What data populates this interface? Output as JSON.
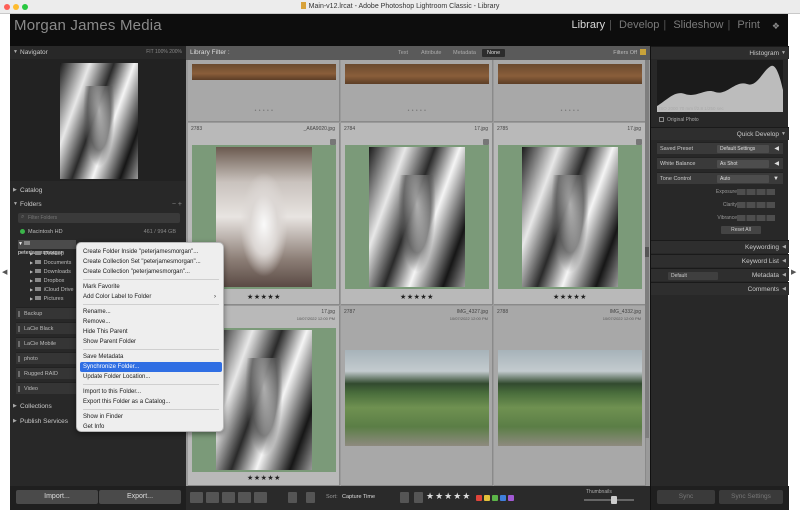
{
  "window": {
    "title": "Main-v12.lrcat - Adobe Photoshop Lightroom Classic - Library",
    "traffic_colors": [
      "#fe5f57",
      "#febc2e",
      "#28c840"
    ]
  },
  "header": {
    "identity_plate": "Morgan James Media",
    "modules": [
      "Library",
      "Develop",
      "Slideshow",
      "Print"
    ],
    "active_module": "Library"
  },
  "left_panel": {
    "navigator": {
      "title": "Navigator",
      "zoom_options": "FIT  100%  200%"
    },
    "catalog": {
      "title": "Catalog"
    },
    "folders": {
      "title": "Folders",
      "search_placeholder": "Filter Folders",
      "volume": {
        "name": "Macintosh HD",
        "meta": "461 / 994 GB"
      },
      "root_folder": "peterjamesmorgan",
      "subfolders": [
        "Desktop",
        "Documents",
        "Downloads",
        "Dropbox",
        "iCloud Drive",
        "Pictures"
      ],
      "drives": [
        "Backup",
        "LaCie Black",
        "LaCie Mobile",
        "photo",
        "Rugged RAID",
        "Video"
      ]
    },
    "collections": {
      "title": "Collections"
    },
    "publish_services": {
      "title": "Publish Services"
    },
    "import_label": "Import...",
    "export_label": "Export..."
  },
  "filter_bar": {
    "title": "Library Filter :",
    "tabs": [
      "Text",
      "Attribute",
      "Metadata",
      "None"
    ],
    "active_tab": "None",
    "filters_off": "Filters Off"
  },
  "grid": {
    "cells": [
      {
        "num": "",
        "name": "",
        "sub": "",
        "stars": ""
      },
      {
        "num": "",
        "name": "",
        "sub": "",
        "stars": ""
      },
      {
        "num": "",
        "name": "",
        "sub": "",
        "stars": ""
      },
      {
        "num": "2783",
        "name": "_A6A9020.jpg",
        "sub": "",
        "stars": "★★★★★"
      },
      {
        "num": "2784",
        "name": "17.jpg",
        "sub": "",
        "stars": "★★★★★"
      },
      {
        "num": "2785",
        "name": "17.jpg",
        "sub": "",
        "stars": "★★★★★"
      },
      {
        "num": "2786",
        "name": "17.jpg",
        "sub": "10/07/2022 12:00 PM",
        "stars": "★★★★★"
      },
      {
        "num": "2787",
        "name": "IMG_4327.jpg",
        "sub": "10/07/2022 12:00 PM",
        "stars": ""
      },
      {
        "num": "2788",
        "name": "IMG_4332.jpg",
        "sub": "10/07/2022 12:00 PM",
        "stars": ""
      }
    ]
  },
  "toolbar": {
    "sort_label": "Sort:",
    "sort_value": "Capture Time",
    "stars": "★★★★★",
    "label_colors": [
      "#e0443a",
      "#e3c13a",
      "#5cb548",
      "#3f7fdc",
      "#a259d4"
    ],
    "thumbnails_label": "Thumbnails"
  },
  "right_panel": {
    "histogram": {
      "title": "Histogram",
      "info": "ISO 2000   70 mm   f/2.8   1/250 sec",
      "original_photo": "Original Photo"
    },
    "quick_develop": {
      "title": "Quick Develop",
      "saved_preset_label": "Saved Preset",
      "saved_preset_value": "Default Settings",
      "white_balance_label": "White Balance",
      "white_balance_value": "As Shot",
      "tone_control_label": "Tone Control",
      "tone_control_value": "Auto",
      "sliders": [
        "Exposure",
        "Clarity",
        "Vibrance"
      ],
      "reset_all": "Reset All"
    },
    "keywording": {
      "title": "Keywording"
    },
    "keyword_list": {
      "title": "Keyword List"
    },
    "metadata": {
      "title": "Metadata",
      "preset": "Default"
    },
    "comments": {
      "title": "Comments"
    },
    "sync_label": "Sync",
    "sync_settings_label": "Sync Settings"
  },
  "context_menu": {
    "items": [
      "Create Folder Inside \"peterjamesmorgan\"...",
      "Create Collection Set \"peterjamesmorgan\"...",
      "Create Collection \"peterjamesmorgan\"...",
      "Mark Favorite",
      "Add Color Label to Folder",
      "Rename...",
      "Remove...",
      "Hide This Parent",
      "Show Parent Folder",
      "Save Metadata",
      "Synchronize Folder...",
      "Update Folder Location...",
      "Import to this Folder...",
      "Export this Folder as a Catalog...",
      "Show in Finder",
      "Get Info"
    ],
    "highlighted": "Synchronize Folder...",
    "submenu_arrow": "›"
  }
}
